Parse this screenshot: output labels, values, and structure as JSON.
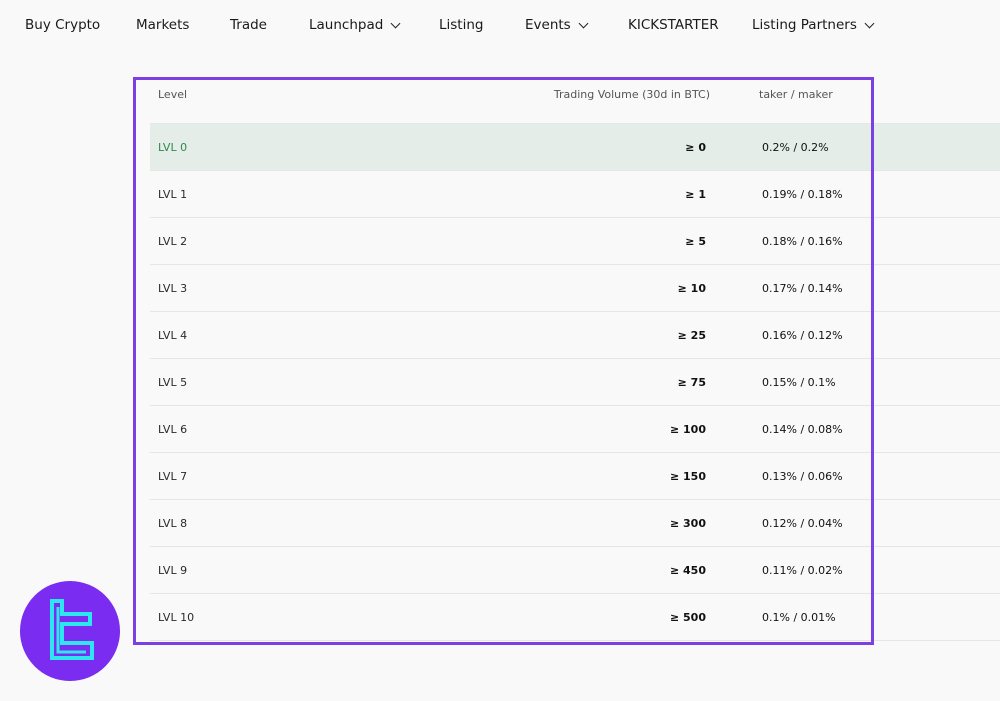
{
  "nav": {
    "items": [
      {
        "label": "Buy Crypto",
        "has_dropdown": false
      },
      {
        "label": "Markets",
        "has_dropdown": false
      },
      {
        "label": "Trade",
        "has_dropdown": false
      },
      {
        "label": "Launchpad",
        "has_dropdown": true
      },
      {
        "label": "Listing",
        "has_dropdown": false
      },
      {
        "label": "Events",
        "has_dropdown": true
      },
      {
        "label": "KICKSTARTER",
        "has_dropdown": false
      },
      {
        "label": "Listing Partners",
        "has_dropdown": true
      }
    ]
  },
  "fee_table": {
    "headers": {
      "level": "Level",
      "volume": "Trading Volume (30d in BTC)",
      "fee": "taker / maker"
    },
    "rows": [
      {
        "level": "LVL 0",
        "volume": "≥ 0",
        "fee": "0.2% / 0.2%"
      },
      {
        "level": "LVL 1",
        "volume": "≥ 1",
        "fee": "0.19% / 0.18%"
      },
      {
        "level": "LVL 2",
        "volume": "≥ 5",
        "fee": "0.18% / 0.16%"
      },
      {
        "level": "LVL 3",
        "volume": "≥ 10",
        "fee": "0.17% / 0.14%"
      },
      {
        "level": "LVL 4",
        "volume": "≥ 25",
        "fee": "0.16% / 0.12%"
      },
      {
        "level": "LVL 5",
        "volume": "≥ 75",
        "fee": "0.15% / 0.1%"
      },
      {
        "level": "LVL 6",
        "volume": "≥ 100",
        "fee": "0.14% / 0.08%"
      },
      {
        "level": "LVL 7",
        "volume": "≥ 150",
        "fee": "0.13% / 0.06%"
      },
      {
        "level": "LVL 8",
        "volume": "≥ 300",
        "fee": "0.12% / 0.04%"
      },
      {
        "level": "LVL 9",
        "volume": "≥ 450",
        "fee": "0.11% / 0.02%"
      },
      {
        "level": "LVL 10",
        "volume": "≥ 500",
        "fee": "0.1% / 0.01%"
      }
    ],
    "active_row": 0
  },
  "colors": {
    "highlight_frame": "#7b3fe4",
    "active_row_bg": "#e4ede8",
    "active_level_text": "#2f8a4e",
    "logo_bg": "#7a2cf0",
    "logo_mark": "#2ee6f0"
  },
  "logo": {
    "icon": "tradingfinder-logo-icon"
  }
}
